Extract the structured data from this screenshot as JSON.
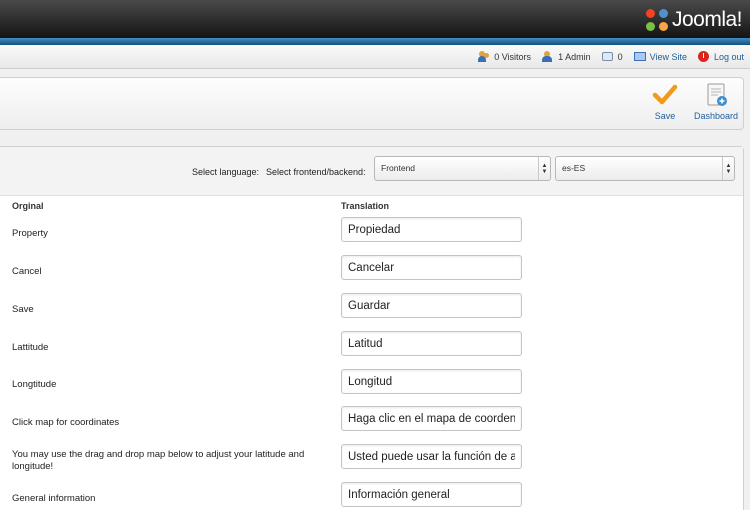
{
  "brand": {
    "logo_text": "Joomla!"
  },
  "status": {
    "visitors": "0 Visitors",
    "admins": "1 Admin",
    "messages": "0",
    "view_site": "View Site",
    "logout": "Log out"
  },
  "toolbar": {
    "save_label": "Save",
    "dashboard_label": "Dashboard"
  },
  "filters": {
    "language_label": "Select language:",
    "frontend_label": "Select frontend/backend:",
    "scope_value": "Frontend",
    "language_value": "es-ES"
  },
  "table": {
    "col_original": "Orginal",
    "col_translation": "Translation",
    "rows": [
      {
        "original": "Property",
        "translation": "Propiedad"
      },
      {
        "original": "Cancel",
        "translation": "Cancelar"
      },
      {
        "original": "Save",
        "translation": "Guardar"
      },
      {
        "original": "Lattitude",
        "translation": "Latitud"
      },
      {
        "original": "Longtitude",
        "translation": "Longitud"
      },
      {
        "original": "Click map for coordinates",
        "translation": "Haga clic en el mapa de coordenadas"
      },
      {
        "original": "You may use the drag and drop map below to adjust your latitude and longitude!",
        "translation": "Usted puede usar la función de arrastrar y soltar"
      },
      {
        "original": "General information",
        "translation": "Información general"
      }
    ]
  },
  "colors": {
    "accent": "#1f5f9a",
    "header_blue": "#2a7ab8",
    "save_check": "#f29a17"
  },
  "icons": [
    "users-icon",
    "admin-icon",
    "messages-icon",
    "view-site-icon",
    "logout-icon",
    "save-check-icon",
    "dashboard-icon",
    "joomla-logo-icon"
  ]
}
